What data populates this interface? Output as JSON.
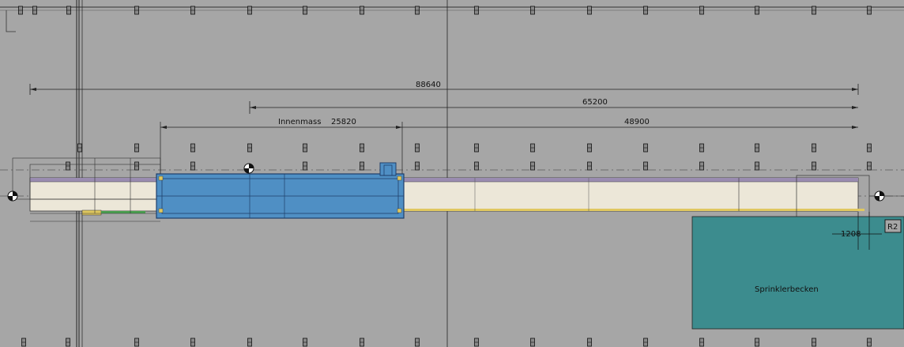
{
  "drawing": {
    "dimensions": {
      "overall": "88640",
      "right_span": "65200",
      "innenmass_label": "Innenmass",
      "innenmass_value": "25820",
      "right_inner": "48900",
      "small_offset": "1208"
    },
    "labels": {
      "sprinkler": "Sprinklerbecken",
      "room_tag": "R2"
    },
    "colors": {
      "background": "#a6a6a6",
      "highlight_box": "#4f8fc4",
      "sprinkler_basin": "#3c8c8e",
      "building_strip": "#ece7d8",
      "roof_edge": "#9a8cb0",
      "yellow_trim": "#e0c860",
      "green_trim": "#4aa050"
    },
    "icons": [
      "section-marker-icon",
      "column-marker-icon"
    ]
  }
}
